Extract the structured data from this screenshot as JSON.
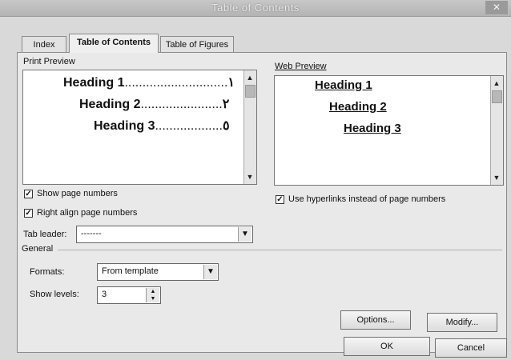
{
  "window": {
    "title": "Table of Contents",
    "close_glyph": "✕"
  },
  "tabs": [
    {
      "label": "Index",
      "active": false
    },
    {
      "label": "Table of Contents",
      "active": true
    },
    {
      "label": "Table of Figures",
      "active": false
    }
  ],
  "print_preview": {
    "label": "Print Preview",
    "entries": [
      {
        "text": "Heading 1",
        "leader": ".............................",
        "page": "١"
      },
      {
        "text": "Heading 2",
        "leader": ".......................",
        "page": "٢"
      },
      {
        "text": "Heading 3",
        "leader": "...................",
        "page": "٥"
      }
    ]
  },
  "web_preview": {
    "label": "Web Preview",
    "entries": [
      "Heading 1",
      "Heading 2",
      "Heading 3"
    ]
  },
  "options": {
    "show_page_numbers": {
      "label": "Show page numbers",
      "checked": true
    },
    "right_align": {
      "label": "Right align page numbers",
      "checked": true
    },
    "use_hyperlinks": {
      "label": "Use hyperlinks instead of page numbers",
      "checked": true
    },
    "tab_leader": {
      "label": "Tab leader:",
      "value": "-------"
    }
  },
  "general": {
    "label": "General",
    "formats": {
      "label": "Formats:",
      "value": "From template"
    },
    "show_levels": {
      "label": "Show levels:",
      "value": "3"
    }
  },
  "buttons": {
    "options": "Options...",
    "modify": "Modify...",
    "ok": "OK",
    "cancel": "Cancel"
  }
}
